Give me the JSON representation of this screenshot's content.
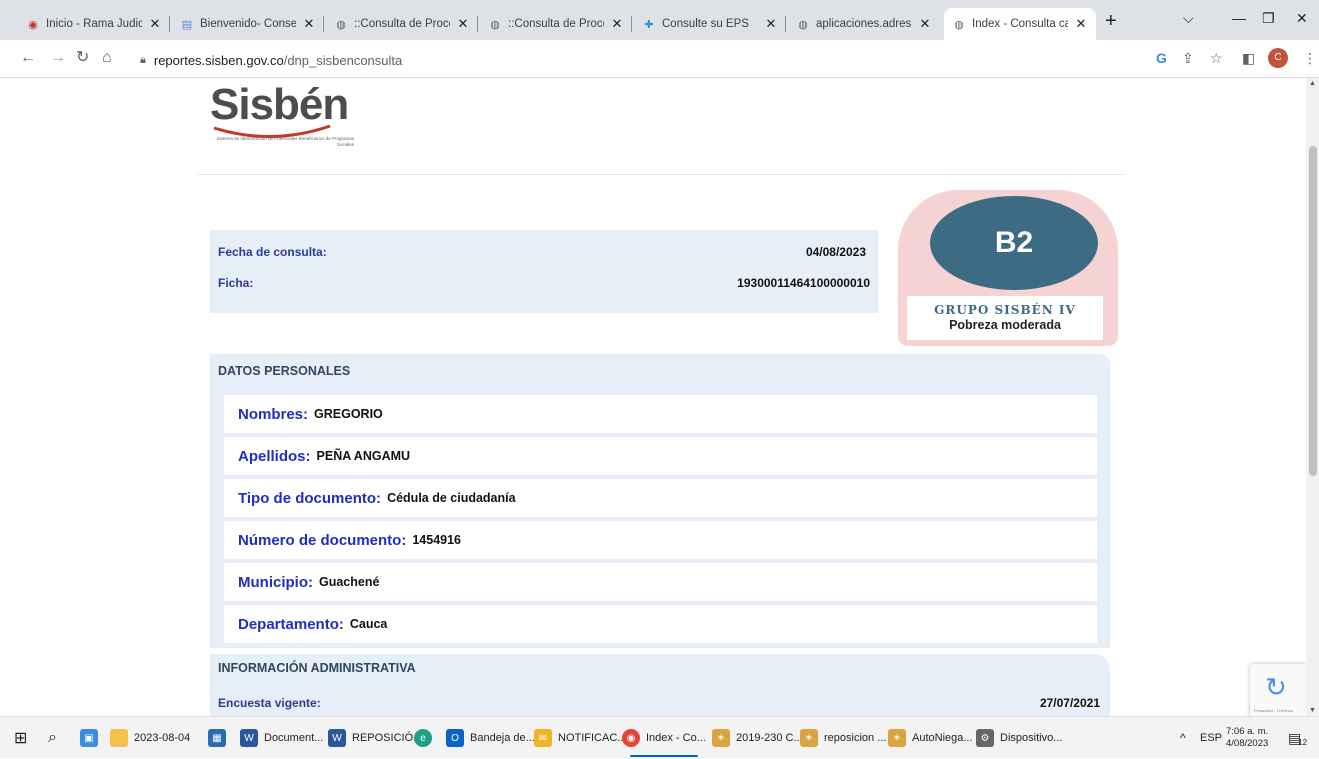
{
  "browser": {
    "tabs": [
      {
        "label": "Inicio - Rama Judicial",
        "icon": "rama-judicial-icon"
      },
      {
        "label": "Bienvenido- Consejo S",
        "icon": "document-icon"
      },
      {
        "label": "::Consulta de Proceso",
        "icon": "globe-icon"
      },
      {
        "label": "::Consulta de Proceso",
        "icon": "globe-icon"
      },
      {
        "label": "Consulte su EPS",
        "icon": "plus-cross-icon"
      },
      {
        "label": "aplicaciones.adres.go",
        "icon": "globe-icon"
      },
      {
        "label": "Index - Consulta cate",
        "icon": "globe-icon"
      }
    ],
    "active_tab": 6,
    "url_host": "reportes.sisben.gov.co",
    "url_path": "/dnp_sisbenconsulta",
    "profile_initial": "C"
  },
  "logo": {
    "text": "Sisbén",
    "tagline": "Sistema de Identificación de Potenciales Beneficiarios de Programas Sociales"
  },
  "consulta": {
    "fecha_label": "Fecha de consulta:",
    "fecha_value": "04/08/2023",
    "ficha_label": "Ficha:",
    "ficha_value": "19300011464100000010"
  },
  "grupo": {
    "code": "B2",
    "group": "GRUPO SISBÉN IV",
    "description": "Pobreza moderada",
    "colors": {
      "oval": "#3d6b84",
      "background": "#f5d3d3"
    }
  },
  "datos_personales": {
    "title": "DATOS PERSONALES",
    "fields": [
      {
        "label": "Nombres:",
        "value": "GREGORIO"
      },
      {
        "label": "Apellidos:",
        "value": "PEÑA ANGAMU"
      },
      {
        "label": "Tipo de documento:",
        "value": "Cédula de ciudadanía"
      },
      {
        "label": "Número de documento:",
        "value": "1454916"
      },
      {
        "label": "Municipio:",
        "value": "Guachené"
      },
      {
        "label": "Departamento:",
        "value": "Cauca"
      }
    ]
  },
  "info_admin": {
    "title": "INFORMACIÓN ADMINISTRATIVA",
    "encuesta_label": "Encuesta vigente:",
    "encuesta_value": "27/07/2021"
  },
  "recaptcha": {
    "text": "Privacidad - Términos"
  },
  "taskbar": {
    "items": [
      {
        "label": "2023-08-04",
        "icon": "folder-icon"
      },
      {
        "label": "Document...",
        "icon": "word-icon"
      },
      {
        "label": "REPOSICIÓ...",
        "icon": "word-icon"
      },
      {
        "label": "Bandeja de...",
        "icon": "outlook-icon"
      },
      {
        "label": "NOTIFICAC...",
        "icon": "mail-icon"
      },
      {
        "label": "Index - Co...",
        "icon": "chrome-icon"
      },
      {
        "label": "2019-230 C...",
        "icon": "app-icon"
      },
      {
        "label": "reposicion ...",
        "icon": "app-icon"
      },
      {
        "label": "AutoNiega...",
        "icon": "app-icon"
      },
      {
        "label": "Dispositivo...",
        "icon": "device-icon"
      }
    ],
    "language": "ESP",
    "time": "7:06 a. m.",
    "date": "4/08/2023",
    "notifications": "12"
  }
}
